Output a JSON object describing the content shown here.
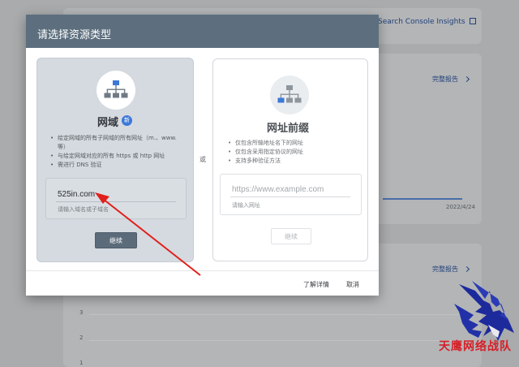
{
  "background": {
    "insights_link": "Search Console Insights",
    "report_link_1": "完整报告",
    "report_link_2": "完整报告",
    "chart_date": "2022/4/24",
    "y_ticks": [
      "3",
      "2",
      "1"
    ]
  },
  "dialog": {
    "title": "请选择资源类型",
    "or_label": "或",
    "domain_card": {
      "title": "网域",
      "badge": "新",
      "features": [
        "给定网域的所有子网域的所有网址（m.、www. 等）",
        "与给定网域对应的所有 https 或 http 网址",
        "需进行 DNS 验证"
      ],
      "input_value": "525in.com",
      "input_hint": "请输入域名或子域名",
      "continue_label": "继续"
    },
    "prefix_card": {
      "title": "网址前缀",
      "features": [
        "仅包含所输地址名下的网址",
        "仅包含采用指定协议的网址",
        "支持多种验证方法"
      ],
      "input_placeholder": "https://www.example.com",
      "input_hint": "请输入网址",
      "continue_label": "继续"
    },
    "footer": {
      "learn_more": "了解详情",
      "cancel": "取消"
    }
  },
  "watermark": {
    "text": "天鹰网络战队"
  },
  "colors": {
    "header": "#5d6f7e",
    "domain_card_bg": "#d5dae0",
    "badge": "#3c78d8",
    "arrow": "#e0201c",
    "watermark_text": "#d81e27",
    "eagle": "#1d2a9c"
  }
}
